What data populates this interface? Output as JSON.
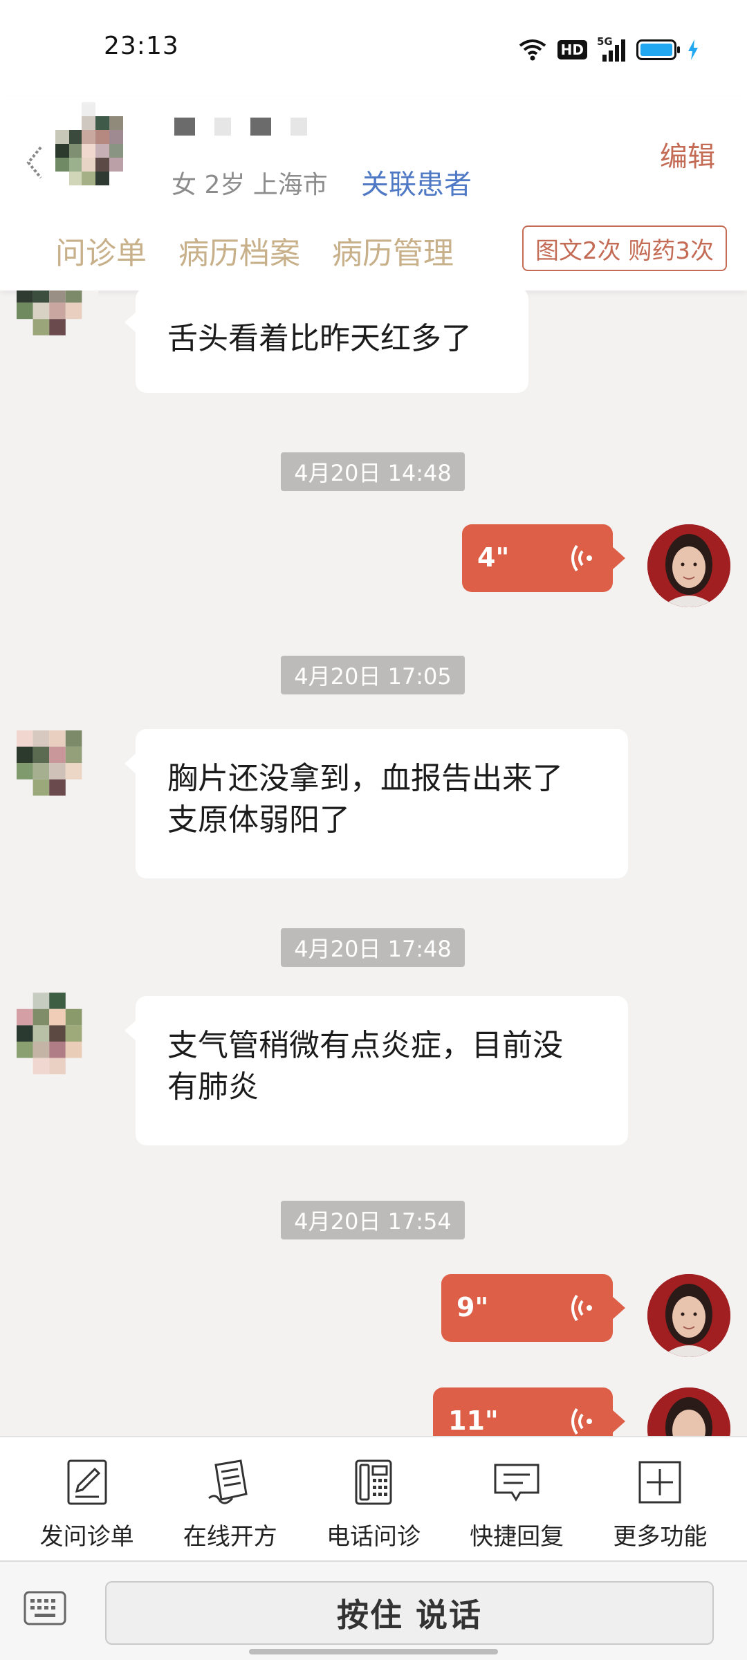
{
  "status_bar": {
    "time": "23:13",
    "network": "5G",
    "hd": "HD",
    "battery_level": 1.0,
    "battery_color": "#22a8f0"
  },
  "header": {
    "patient_info": "女 2岁  上海市",
    "link_patient": "关联患者",
    "edit": "编辑",
    "tabs": [
      "问诊单",
      "病历档案",
      "病历管理"
    ],
    "stats": "图文2次 购药3次"
  },
  "chat": {
    "messages": [
      {
        "type": "text_in",
        "text": "舌头看着比昨天红多了"
      },
      {
        "type": "time",
        "text": "4月20日 14:48"
      },
      {
        "type": "voice_out",
        "duration": "4\""
      },
      {
        "type": "time",
        "text": "4月20日 17:05"
      },
      {
        "type": "text_in",
        "lines": [
          "胸片还没拿到，血报告出来了",
          "支原体弱阳了"
        ]
      },
      {
        "type": "time",
        "text": "4月20日 17:48"
      },
      {
        "type": "text_in",
        "lines": [
          "支气管稍微有点炎症，目前没",
          "有肺炎"
        ]
      },
      {
        "type": "time",
        "text": "4月20日 17:54"
      },
      {
        "type": "voice_out",
        "duration": "9\""
      },
      {
        "type": "voice_out",
        "duration": "11\""
      }
    ]
  },
  "functions": [
    {
      "label": "发问诊单",
      "icon": "form-icon"
    },
    {
      "label": "在线开方",
      "icon": "prescription-icon"
    },
    {
      "label": "电话问诊",
      "icon": "phone-icon"
    },
    {
      "label": "快捷回复",
      "icon": "quick-reply-icon"
    },
    {
      "label": "更多功能",
      "icon": "more-icon"
    }
  ],
  "input": {
    "talk_button": "按住 说话"
  },
  "colors": {
    "accent_red": "#dd5f47",
    "tab_gold": "#c7b08a",
    "link_blue": "#4f79c4",
    "edit_red": "#c46b55"
  }
}
